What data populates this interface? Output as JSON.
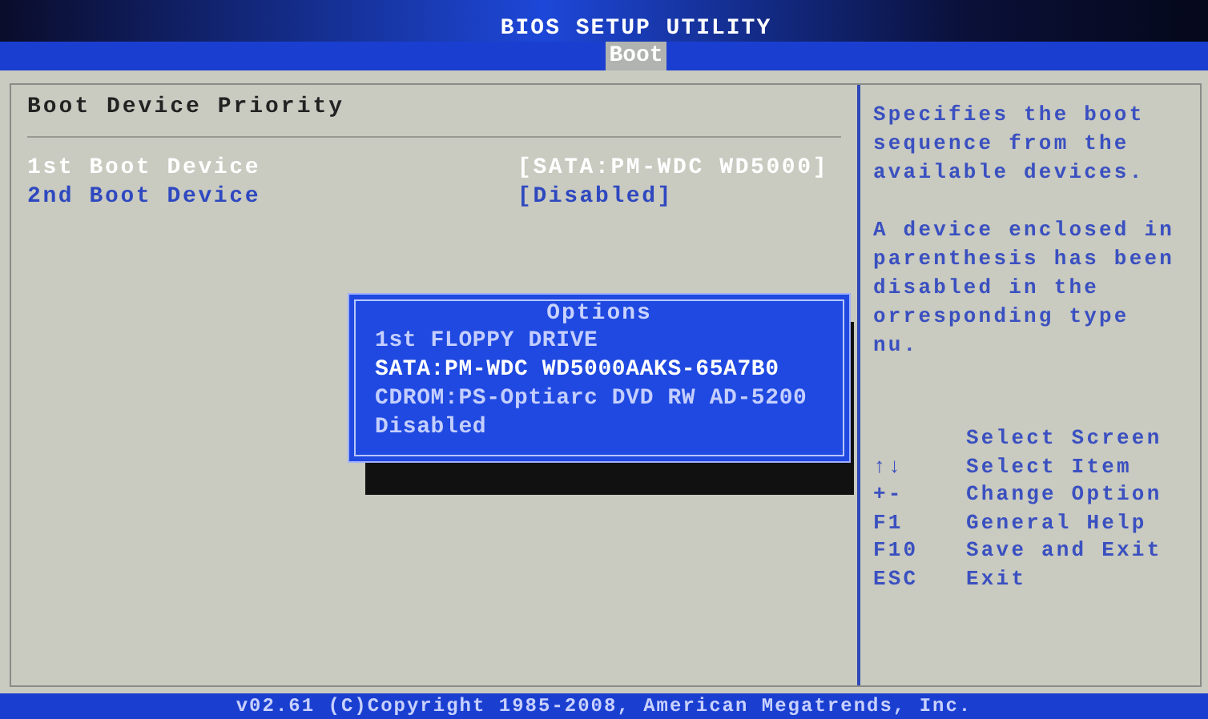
{
  "header": {
    "title": "BIOS SETUP UTILITY"
  },
  "tabs": [
    {
      "label": "Boot",
      "selected": true
    }
  ],
  "main": {
    "title": "Boot Device Priority",
    "items": [
      {
        "label": "1st Boot Device",
        "value": "[SATA:PM-WDC WD5000]",
        "selected": true
      },
      {
        "label": "2nd Boot Device",
        "value": "[Disabled]",
        "selected": false
      }
    ]
  },
  "options_popup": {
    "title": "Options",
    "options": [
      {
        "label": "1st FLOPPY DRIVE",
        "selected": false
      },
      {
        "label": "SATA:PM-WDC WD5000AAKS-65A7B0",
        "selected": true
      },
      {
        "label": "CDROM:PS-Optiarc DVD RW AD-5200",
        "selected": false
      },
      {
        "label": "Disabled",
        "selected": false
      }
    ]
  },
  "help": {
    "paragraphs": [
      [
        "Specifies the boot",
        "sequence from the",
        "available devices."
      ],
      [
        "A device enclosed in",
        "parenthesis has been",
        "disabled in the",
        "orresponding type",
        "nu."
      ]
    ],
    "keys": [
      {
        "action": "Select Screen"
      },
      {
        "key": "↑↓",
        "action": "Select Item"
      },
      {
        "key": "+-",
        "action": "Change Option"
      },
      {
        "key": "F1",
        "action": "General Help"
      },
      {
        "key": "F10",
        "action": "Save and Exit"
      },
      {
        "key": "ESC",
        "action": "Exit"
      }
    ]
  },
  "footer": {
    "text": "v02.61 (C)Copyright 1985-2008, American Megatrends, Inc."
  }
}
